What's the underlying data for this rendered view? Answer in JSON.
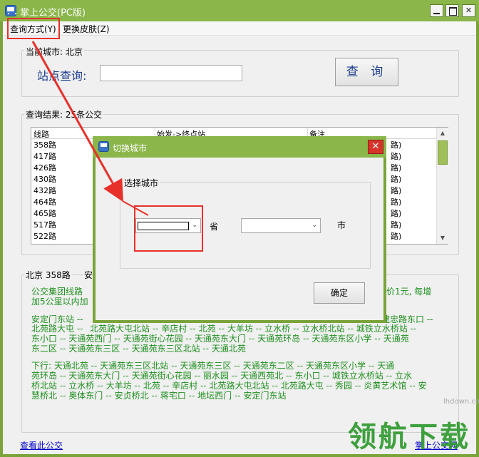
{
  "window": {
    "title": "掌上公交(PC版)"
  },
  "menu": {
    "query_mode": "查询方式(Y)",
    "change_skin": "更换皮肤(Z)"
  },
  "current_city": {
    "label": "当前城市: 北京"
  },
  "station": {
    "label": "站点查询:",
    "value": "",
    "button": "查 询"
  },
  "results": {
    "label": "查询结果: 25条公交",
    "columns": [
      "线路",
      "始发->终点站",
      "备注"
    ],
    "rows": [
      {
        "line": "358路",
        "note": "路)"
      },
      {
        "line": "417路",
        "note": "路)"
      },
      {
        "line": "426路",
        "note": "路)"
      },
      {
        "line": "430路",
        "note": "路)"
      },
      {
        "line": "432路",
        "note": "路)"
      },
      {
        "line": "464路",
        "note": "路)"
      },
      {
        "line": "465路",
        "note": "路)"
      },
      {
        "line": "517路",
        "note": "路)"
      },
      {
        "line": "522路",
        "note": "路)"
      }
    ]
  },
  "detail": {
    "title": "北京 358路",
    "title_tail": "安",
    "lines": [
      "公交集团线路",
      "加5公里以内加",
      "安定门东站 --",
      "北苑路大屯 --",
      "东小口 -- 天通苑西门 -- 天通苑街心花园 -- 天通苑东大门 -- 天通苑环岛 -- 天通苑东区小学 -- 天通苑",
      "东二区 -- 天通苑东三区 -- 天通苑东三区北站 -- 天通北苑",
      "下行:      天通北苑 -- 天通苑东三区北站 -- 天通苑东三区 -- 天通苑东二区 -- 天通苑东区小学 -- 天通",
      "苑环岛 -- 天通苑东大门 -- 天通苑街心花园 -- 丽水园 -- 天通西苑北 -- 东小口 -- 城铁立水桥站 -- 立水",
      "桥北站 -- 立水桥 -- 大羊坊 -- 北苑 -- 辛店村 -- 北苑路大屯北站 -- 北苑路大屯 -- 秀园 -- 炎黄艺术馆 -- 安",
      "慧桥北 -- 奥体东门 -- 安贞桥北 -- 蒋宅口 -- 地坛西门 -- 安定门东站"
    ],
    "line1_right": "价1元, 每增",
    "line3_right": "建忠路东口 --",
    "line4_mid": "北苑路大屯北站 -- 辛店村 -- 北苑 -- 大羊坊 -- 立水桥 -- 立水桥北站 -- 城铁立水桥站 --",
    "line3_mid": "北"
  },
  "footer": {
    "view_link": "查看此公交",
    "home_link": "掌上公交网"
  },
  "dialog": {
    "title": "切换城市",
    "group_label": "选择城市",
    "province_value": "",
    "province_label": "省",
    "city_value": "",
    "city_label": "市",
    "ok": "确定"
  },
  "watermark": {
    "small": "lhdown.com",
    "big": "领航下载"
  },
  "colors": {
    "title_bar": "#8ab64a",
    "detail_text": "#1d8f1d",
    "highlight_box": "#e8302a"
  }
}
